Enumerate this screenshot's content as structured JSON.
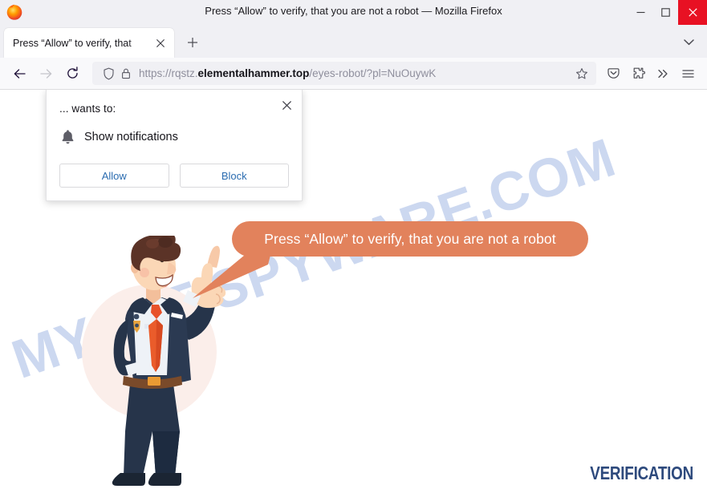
{
  "window": {
    "title": "Press “Allow” to verify, that you are not a robot — Mozilla Firefox",
    "controls": {
      "minimize": "minimize-button",
      "maximize": "maximize-button",
      "close": "close-button"
    },
    "close_color": "#e81123"
  },
  "tabbar": {
    "tabs": [
      {
        "label": "Press “Allow” to verify, that",
        "close_label": "✕",
        "active": true
      }
    ],
    "new_tab_label": "+",
    "list_all_tabs_label": "⌄"
  },
  "toolbar": {
    "back_label": "←",
    "forward_label": "→",
    "reload_label": "⟳",
    "url": {
      "scheme": "https://",
      "subdomain": "rqstz.",
      "host": "elementalhammer.top",
      "path": "/eyes-robot/?pl=NuOuywK",
      "full": "https://rqstz.elementalhammer.top/eyes-robot/?pl=NuOuywK"
    },
    "icons": {
      "shield": "tracking-protection-shield-icon",
      "lock": "connection-lock-icon",
      "bookmark": "bookmark-star-icon",
      "pocket": "save-to-pocket-icon",
      "extensions": "extensions-puzzle-icon",
      "overflow": "overflow-chevrons-icon",
      "appmenu": "hamburger-menu-icon"
    }
  },
  "notification_popup": {
    "host_prompt": "... wants to:",
    "permission": "Show notifications",
    "permission_icon": "bell-icon",
    "allow_label": "Allow",
    "block_label": "Block",
    "close_label": "✕",
    "button_text_color": "#2b6cb0"
  },
  "page": {
    "bubble_text": "Press “Allow” to verify, that you are not a robot",
    "bubble_color": "#e2825c",
    "bubble_text_color": "#ffffff",
    "watermark": "MYANTISPYWARE.COM",
    "watermark_color": "#ccd8f0",
    "footer_label": "VERIFICATION",
    "footer_color": "#2e4a7d",
    "character_alt": "cartoon-businessman-pointing-up",
    "background_color": "#ffffff"
  }
}
